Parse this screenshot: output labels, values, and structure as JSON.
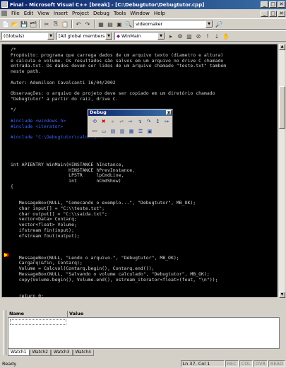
{
  "titlebar": {
    "title": "Final - Microsoft Visual C++ [break] - [C:\\Debugtutor\\Debugtutor.cpp]",
    "min": "_",
    "max": "□",
    "close": "✕"
  },
  "menu": [
    "File",
    "Edit",
    "View",
    "Insert",
    "Project",
    "Debug",
    "Tools",
    "Window",
    "Help"
  ],
  "toolbar1": {
    "find_combo": "videomaker"
  },
  "toolbar2": {
    "globals_combo": "(Globals)",
    "members_combo": "[All global members]",
    "function_combo": "WinMain"
  },
  "code_lines": [
    {
      "t": "/*",
      "c": "cmt"
    },
    {
      "t": "Propósito: programa que carrega dados de um arquivo texto (diametro e altura)",
      "c": "cmt"
    },
    {
      "t": "e calcula o volume. Os resultados são salvos em um arquivo no drive C chamado",
      "c": "cmt"
    },
    {
      "t": "entrada.txt. Os dados devem ser lidos de um arquivo chamado \"teste.txt\" também",
      "c": "cmt"
    },
    {
      "t": "neste path.",
      "c": "cmt"
    },
    {
      "t": "",
      "c": "cmt"
    },
    {
      "t": "Autor: Ademilson Cavalcanti 16/04/2002",
      "c": "cmt"
    },
    {
      "t": "",
      "c": "cmt"
    },
    {
      "t": "Observações: o arquivo de projeto deve ser copiado em um diretório chamado",
      "c": "cmt"
    },
    {
      "t": "\"Debugtutor\" a partir do raiz, drive C.",
      "c": "cmt"
    },
    {
      "t": "",
      "c": "cmt"
    },
    {
      "t": "*/",
      "c": "cmt"
    },
    {
      "t": "",
      "c": "txt"
    },
    {
      "t": "#include <windows.h>",
      "c": "pp"
    },
    {
      "t": "#include <iterator>",
      "c": "pp"
    },
    {
      "t": "",
      "c": "txt"
    },
    {
      "t": "#include \"C:\\Debugtutor\\calcula.h\"",
      "c": "pp"
    },
    {
      "t": "",
      "c": "txt"
    },
    {
      "t": "",
      "c": "txt"
    },
    {
      "t": "",
      "c": "txt"
    },
    {
      "t": "",
      "c": "txt"
    },
    {
      "t": "int APIENTRY WinMain(HINSTANCE hInstance,",
      "c": "txt"
    },
    {
      "t": "                     HINSTANCE hPrevInstance,",
      "c": "txt"
    },
    {
      "t": "                     LPSTR     lpCmdLine,",
      "c": "txt"
    },
    {
      "t": "                     int       nCmdShow)",
      "c": "txt"
    },
    {
      "t": "{",
      "c": "txt"
    },
    {
      "t": "",
      "c": "txt"
    },
    {
      "t": "",
      "c": "txt"
    },
    {
      "t": "   MessageBox(NULL, \"Comecando o exemplo...\", \"Debugtutor\", MB_OK);",
      "c": "txt"
    },
    {
      "t": "   char input[] = \"C:\\\\teste.txt\";",
      "c": "txt"
    },
    {
      "t": "   char output[] = \"C:\\\\saida.txt\";",
      "c": "txt"
    },
    {
      "t": "   vector<Data> Contarq;",
      "c": "txt"
    },
    {
      "t": "   vector<float> Volume;",
      "c": "txt"
    },
    {
      "t": "   ifstream fin(input);",
      "c": "txt"
    },
    {
      "t": "   ofstream fout(output);",
      "c": "txt"
    },
    {
      "t": "",
      "c": "txt"
    },
    {
      "t": "",
      "c": "txt"
    },
    {
      "t": "",
      "c": "txt"
    },
    {
      "t": "   MessageBox(NULL, \"Lendo o arquivo.\", \"Debugtutor\", MB_OK);",
      "c": "txt"
    },
    {
      "t": "   Cargarq(&fin, Contarq);",
      "c": "txt"
    },
    {
      "t": "   Volume = Calcvol(Contarq.begin(), Contarq.end());",
      "c": "txt"
    },
    {
      "t": "   MessageBox(NULL, \"Salvando o volume calculado\", \"Debugtutor\", MB_OK);",
      "c": "txt"
    },
    {
      "t": "   copy(Volume.begin(), Volume.end(), ostream_iterator<float>(fout, \"\\n\"));",
      "c": "txt"
    },
    {
      "t": "",
      "c": "txt"
    },
    {
      "t": "",
      "c": "txt"
    },
    {
      "t": "   return 0;",
      "c": "txt"
    },
    {
      "t": "}",
      "c": "txt"
    }
  ],
  "debug_toolbar": {
    "title": "Debug",
    "close": "x"
  },
  "watch": {
    "col_name": "Name",
    "col_value": "Value",
    "tabs": [
      "Watch1",
      "Watch2",
      "Watch3",
      "Watch4"
    ]
  },
  "status": {
    "text": "Ready",
    "position": "Ln 37, Col 1",
    "rec": "REC",
    "col": "COL",
    "ovr": "OVR",
    "read": "READ"
  }
}
